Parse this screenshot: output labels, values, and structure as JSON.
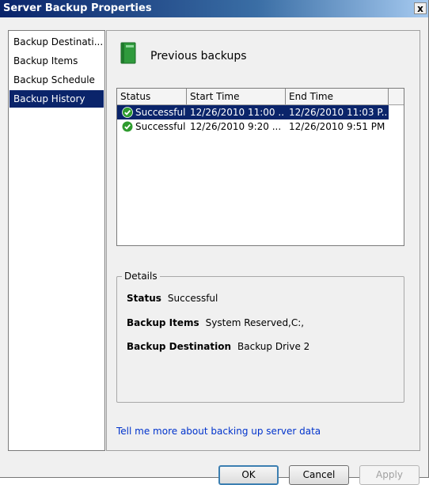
{
  "window": {
    "title": "Server Backup Properties",
    "close_label": "x"
  },
  "sidebar": {
    "items": [
      {
        "label": "Backup Destinati..."
      },
      {
        "label": "Backup Items"
      },
      {
        "label": "Backup Schedule"
      },
      {
        "label": "Backup History",
        "selected": true
      }
    ]
  },
  "content": {
    "header": "Previous backups",
    "list": {
      "columns": [
        "Status",
        "Start Time",
        "End Time"
      ],
      "rows": [
        {
          "status": "Successful",
          "start": "12/26/2010 11:00 ...",
          "end": "12/26/2010 11:03 P...",
          "selected": true
        },
        {
          "status": "Successful",
          "start": "12/26/2010 9:20 ...",
          "end": "12/26/2010 9:51 PM",
          "selected": false
        }
      ]
    },
    "details": {
      "legend": "Details",
      "status_label": "Status",
      "status_value": "Successful",
      "items_label": "Backup Items",
      "items_value": "System Reserved,C:,",
      "dest_label": "Backup Destination",
      "dest_value": "Backup Drive 2"
    },
    "link_text": "Tell me more about backing up server data"
  },
  "buttons": {
    "ok": "OK",
    "cancel": "Cancel",
    "apply": "Apply"
  },
  "colors": {
    "selection": "#0a246a",
    "link": "#0033cc",
    "success_icon": "#2e9b2e",
    "book_icon": "#2f9a3c"
  }
}
